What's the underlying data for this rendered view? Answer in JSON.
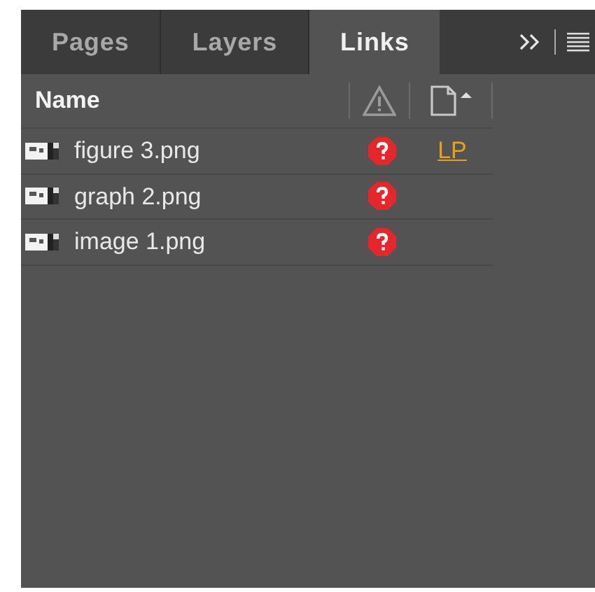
{
  "tabs": [
    {
      "label": "Pages",
      "selected": false
    },
    {
      "label": "Layers",
      "selected": false
    },
    {
      "label": "Links",
      "selected": true
    }
  ],
  "table": {
    "columns": [
      {
        "label": "Name"
      }
    ],
    "rows": [
      {
        "name": "figure 3.png",
        "missing": true,
        "page": "LP"
      },
      {
        "name": "graph 2.png",
        "missing": true
      },
      {
        "name": "image 1.png",
        "missing": true
      }
    ]
  }
}
